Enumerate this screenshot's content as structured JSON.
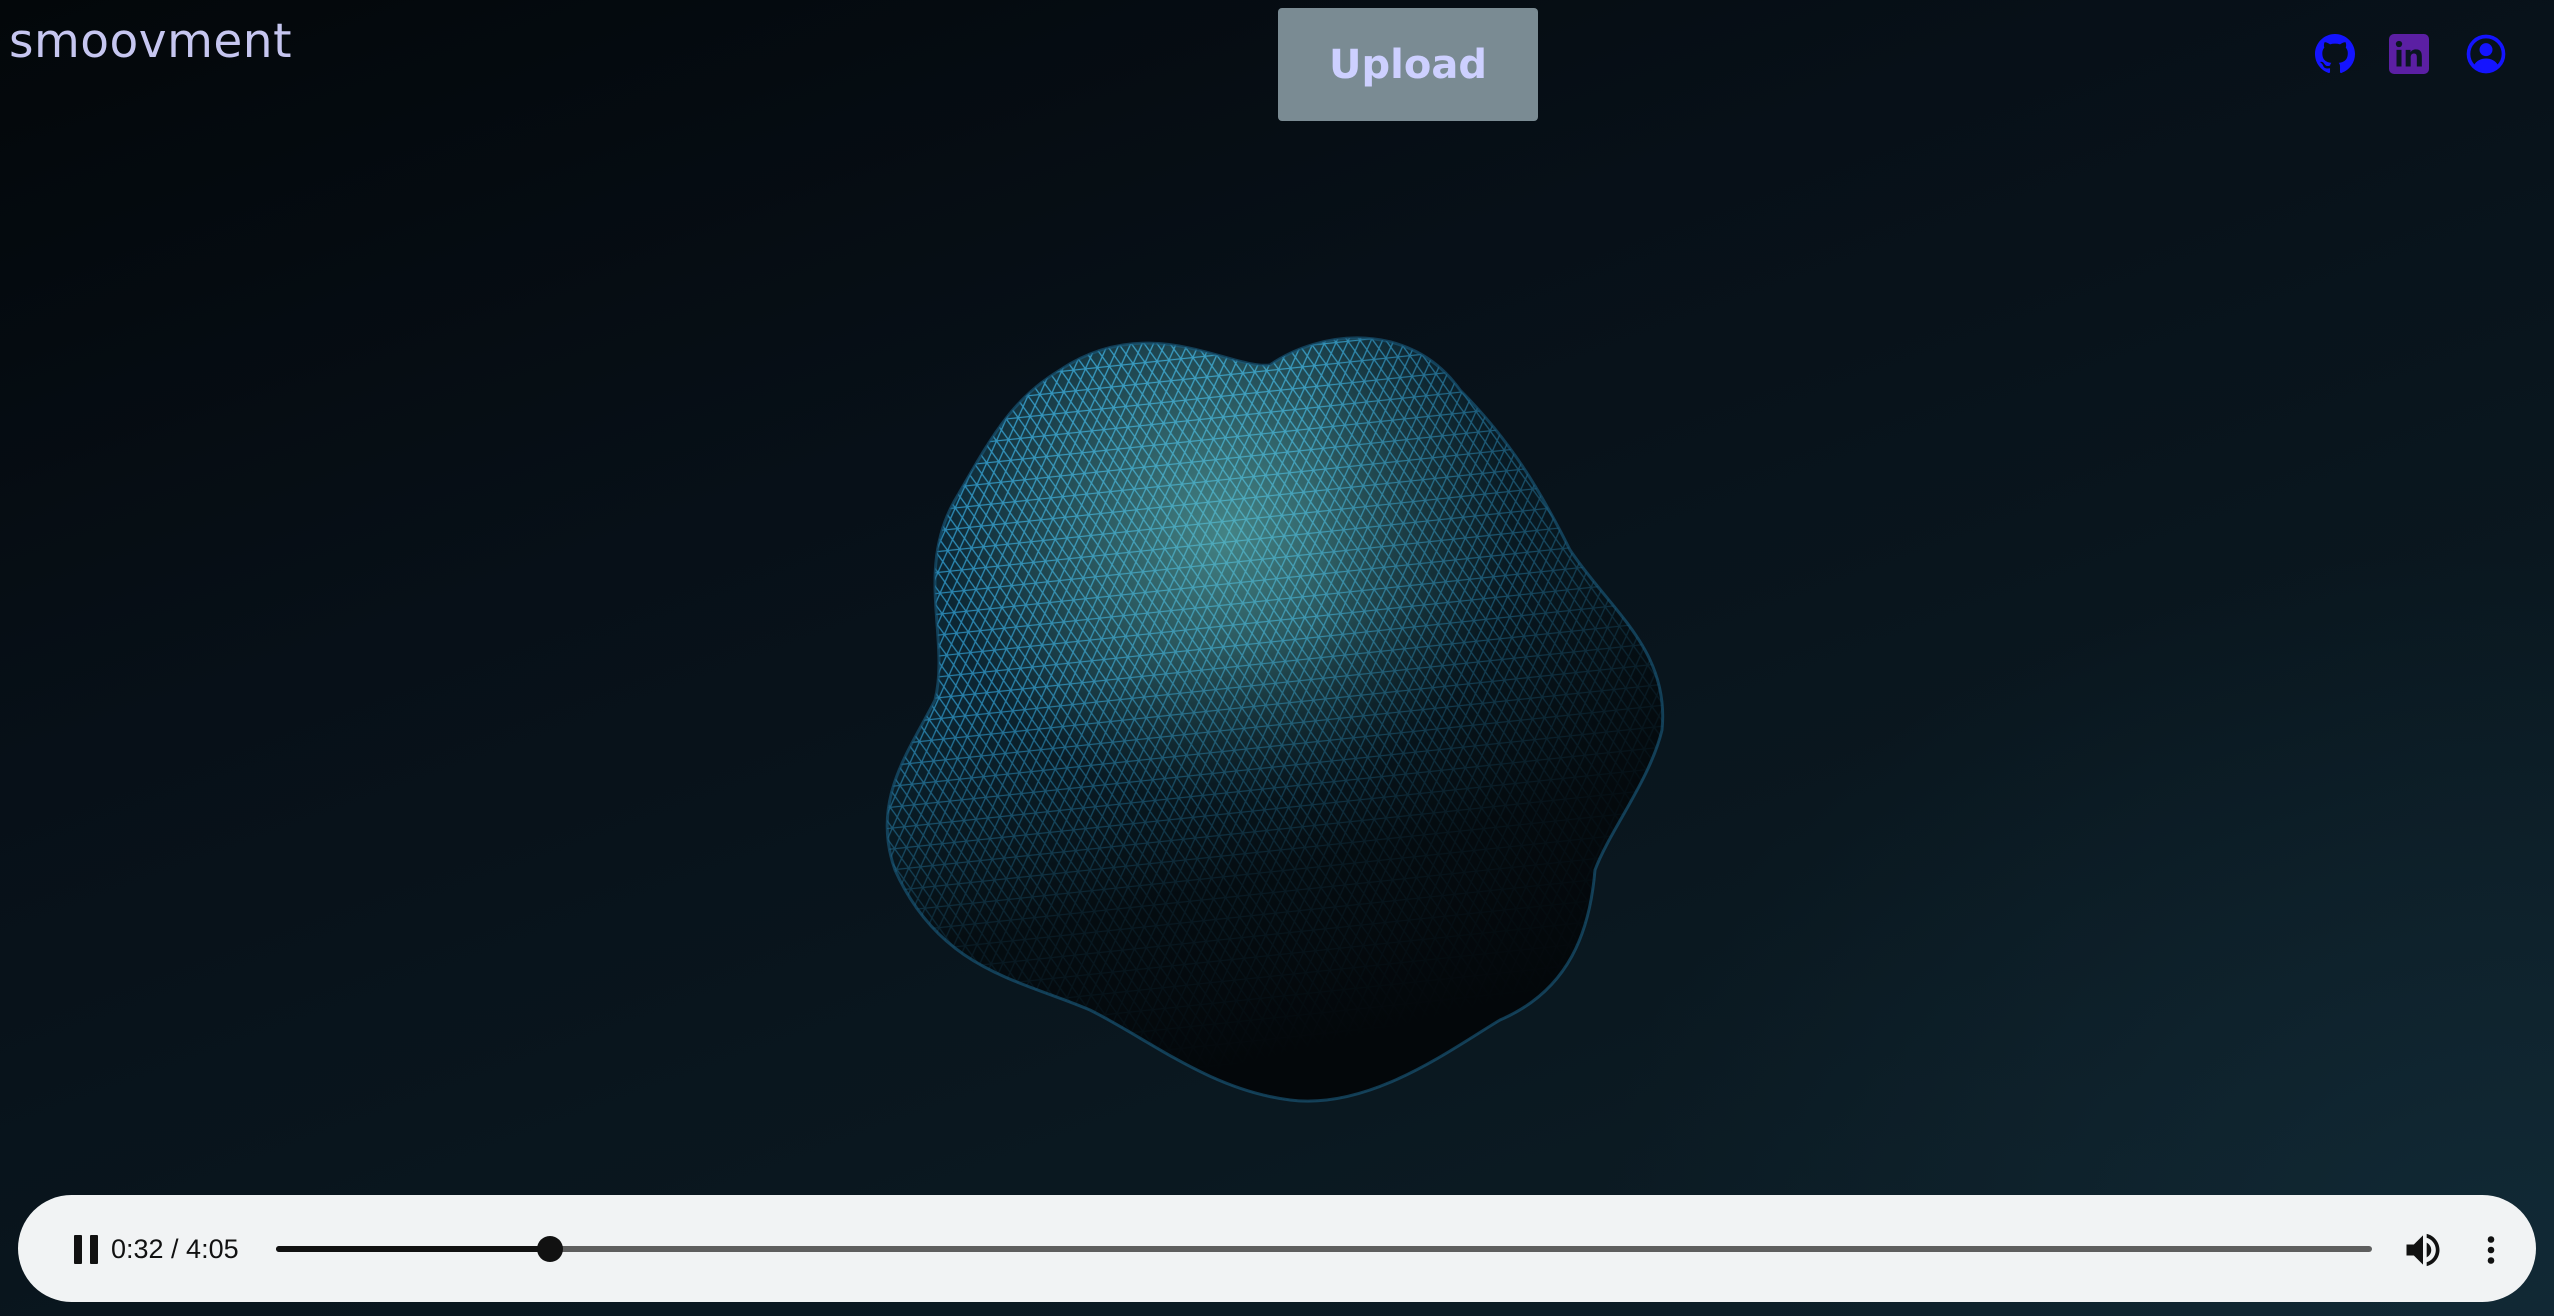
{
  "app": {
    "brand": "smoovment",
    "upload_label": "Upload"
  },
  "header_icons": [
    {
      "icon": "github-icon",
      "color": "#1414ff"
    },
    {
      "icon": "linkedin-icon",
      "color": "#5b1fa3"
    },
    {
      "icon": "account-icon",
      "color": "#1414ff"
    }
  ],
  "visualizer": {
    "object": "wireframe-blob",
    "color": "#2e94c4",
    "highlight": "#7fe8e0"
  },
  "player": {
    "state": "playing",
    "time_display": "0:32 / 4:05",
    "progress": 0.1306,
    "pause_icon": "pause-icon",
    "volume_icon": "volume-icon",
    "more_icon": "more-vertical-icon"
  },
  "colors": {
    "brand_text": "#c6c6f0",
    "upload_bg": "#7a8b93",
    "upload_text": "#cdd0ff",
    "player_bg": "#f1f3f4"
  }
}
